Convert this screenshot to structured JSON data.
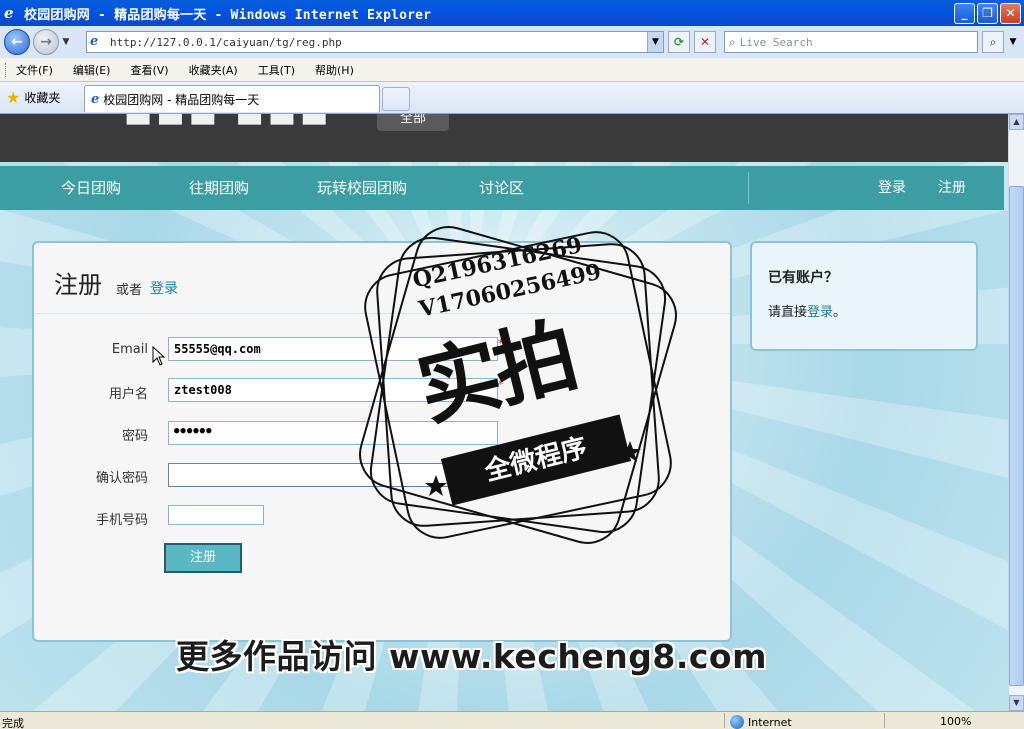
{
  "window": {
    "title": "校园团购网 - 精品团购每一天 - Windows Internet Explorer",
    "buttons": {
      "minimize": "_",
      "restore": "❐",
      "close": "✕"
    }
  },
  "address_bar": {
    "url": "http://127.0.0.1/caiyuan/tg/reg.php",
    "search_placeholder": "Live Search"
  },
  "menu": [
    "文件(F)",
    "编辑(E)",
    "查看(V)",
    "收藏夹(A)",
    "工具(T)",
    "帮助(H)"
  ],
  "favorites_label": "收藏夹",
  "tab": {
    "label": "校园团购网 - 精品团购每一天"
  },
  "site": {
    "all_button": "全部",
    "nav": [
      "今日团购",
      "往期团购",
      "玩转校园团购",
      "讨论区"
    ],
    "nav_right": [
      "登录",
      "注册"
    ]
  },
  "register": {
    "title": "注册",
    "or_text": "或者",
    "login_link": "登录",
    "fields": [
      {
        "label": "Email",
        "value": "55555@qq.com",
        "required": "*"
      },
      {
        "label": "用户名",
        "value": "ztest008",
        "required": "*"
      },
      {
        "label": "密码",
        "value": "●●●●●●"
      },
      {
        "label": "确认密码",
        "value": ""
      },
      {
        "label": "手机号码",
        "value": ""
      }
    ],
    "submit": "注册"
  },
  "sidebox": {
    "title": "已有账户？",
    "text_prefix": "请直接",
    "link": "登录",
    "text_suffix": "。"
  },
  "watermark": {
    "qq": "Q2196316269",
    "v": "V17060256499",
    "big": "实拍",
    "ribbon": "全微程序",
    "bottom": "更多作品访问 www.kecheng8.com"
  },
  "status": {
    "text": "完成",
    "zone": "Internet",
    "zoom": "100%"
  },
  "colors": {
    "nav_teal": "#3c9ea2",
    "link": "#1a7f9c",
    "titlebar": "#0254e3"
  }
}
